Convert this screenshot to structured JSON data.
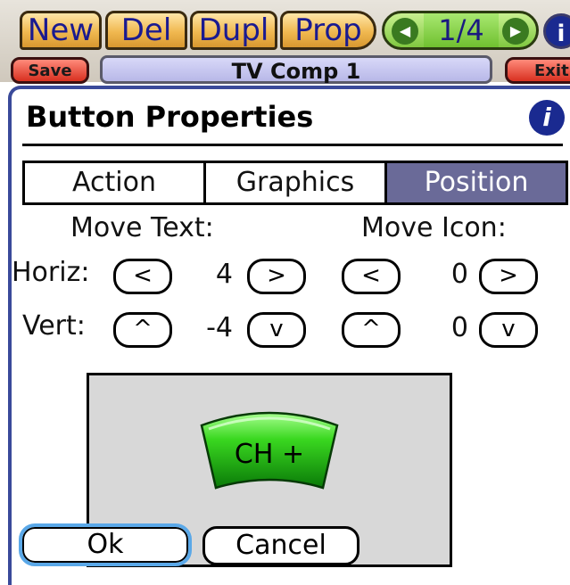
{
  "toolbar": {
    "new_label": "New",
    "del_label": "Del",
    "dupl_label": "Dupl",
    "prop_label": "Prop",
    "pager_text": "1/4",
    "prev_icon": "arrow-left-icon",
    "next_icon": "arrow-right-icon",
    "info_icon": "info-icon",
    "save_label": "Save",
    "title": "TV Comp 1",
    "exit_label": "Exit"
  },
  "dialog": {
    "title": "Button Properties",
    "info_icon": "info-icon",
    "tabs": [
      {
        "label": "Action",
        "selected": false
      },
      {
        "label": "Graphics",
        "selected": false
      },
      {
        "label": "Position",
        "selected": true
      }
    ],
    "move_text_label": "Move Text:",
    "move_icon_label": "Move Icon:",
    "horiz_label": "Horiz:",
    "vert_label": "Vert:",
    "text_horiz_value": "4",
    "text_vert_value": "-4",
    "icon_horiz_value": "0",
    "icon_vert_value": "0",
    "left_btn": "<",
    "right_btn": ">",
    "up_btn": "^",
    "down_btn": "v",
    "preview_label": "CH +",
    "preview_button_color": "#2ecc20",
    "ok_label": "Ok",
    "cancel_label": "Cancel"
  },
  "colors": {
    "selected_tab": "#6a6a98",
    "toolbar_button": "#f0b850",
    "pager": "#80c840",
    "dialog_border": "#3a4a9a",
    "preview_bg": "#d8d8d8"
  }
}
